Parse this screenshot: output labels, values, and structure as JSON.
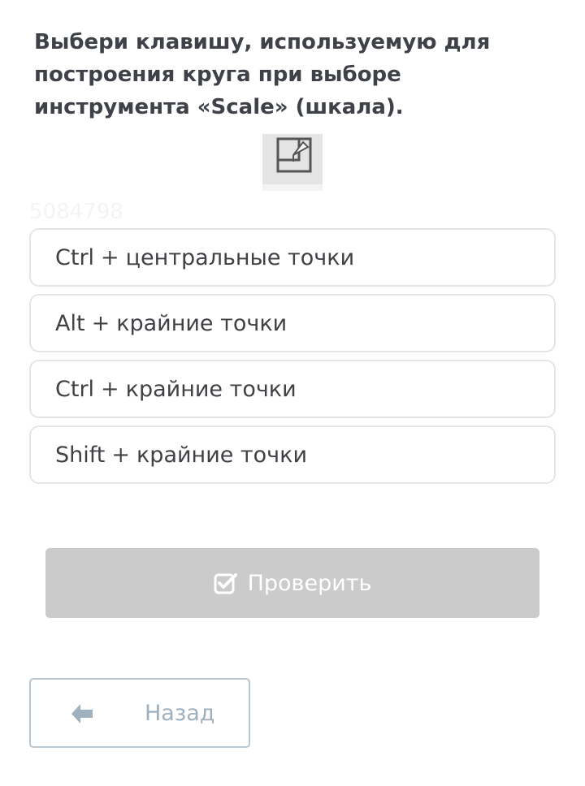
{
  "question": {
    "text": "Выбери клавишу, используемую для построения круга при выборе инструмента «Scale» (шкала)."
  },
  "watermark": "5084798",
  "options": [
    {
      "key": "Ctrl",
      "plus": "+",
      "text": "центральные точки"
    },
    {
      "key": "Alt",
      "plus": "+",
      "text": "крайние точки"
    },
    {
      "key": "Ctrl",
      "plus": "+",
      "text": "крайние точки"
    },
    {
      "key": "Shift",
      "plus": "+",
      "text": "крайние точки"
    }
  ],
  "check_button": {
    "label": "Проверить",
    "icon": "checkbox-check-icon"
  },
  "back_button": {
    "label": "Назад",
    "icon": "arrow-left-icon"
  },
  "colors": {
    "text": "#3e4147",
    "option_border": "#e3e5e8",
    "check_button_bg": "#cbcbcb",
    "back_button_border": "#b9c6d0",
    "back_button_text": "#9fb0be"
  }
}
